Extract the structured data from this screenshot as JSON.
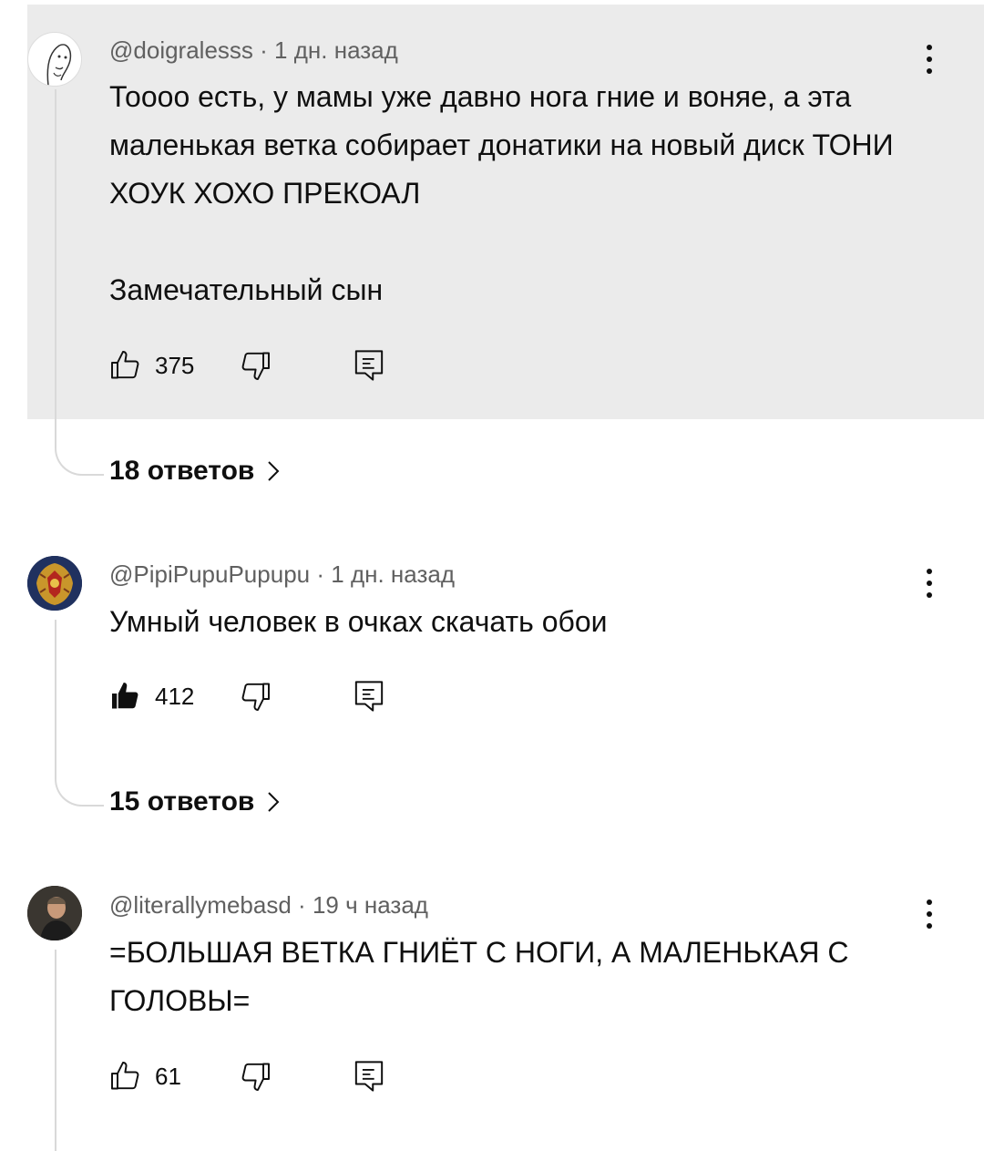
{
  "comments": [
    {
      "author": "@doigralesss",
      "time": "1 дн. назад",
      "text": "Тоооо есть, у мамы уже давно нога гние и воняе, а эта маленькая ветка собирает донатики на новый диск ТОНИ ХОУК ХОХО ПРЕКОАЛ\n\nЗамечательный сын",
      "likes": "375",
      "liked": false,
      "replies": "18 ответов",
      "highlighted": true
    },
    {
      "author": "@PipiPupuPupupu",
      "time": "1 дн. назад",
      "text": "Умный человек в очках скачать обои",
      "likes": "412",
      "liked": true,
      "replies": "15 ответов",
      "highlighted": false
    },
    {
      "author": "@literallymebasd",
      "time": "19 ч назад",
      "text": "=БОЛЬШАЯ ВЕТКА ГНИЁТ С НОГИ, А МАЛЕНЬКАЯ С ГОЛОВЫ=",
      "likes": "61",
      "liked": false,
      "highlighted": false
    }
  ],
  "meta_separator": "·",
  "colors": {
    "highlight_bg": "#ebebeb",
    "text": "#0f0f0f",
    "meta": "#606060",
    "thread": "#d9d9d9"
  },
  "icons": [
    "like-icon",
    "like-filled-icon",
    "dislike-icon",
    "reply-icon",
    "more-vert-icon",
    "chevron-right-icon"
  ]
}
